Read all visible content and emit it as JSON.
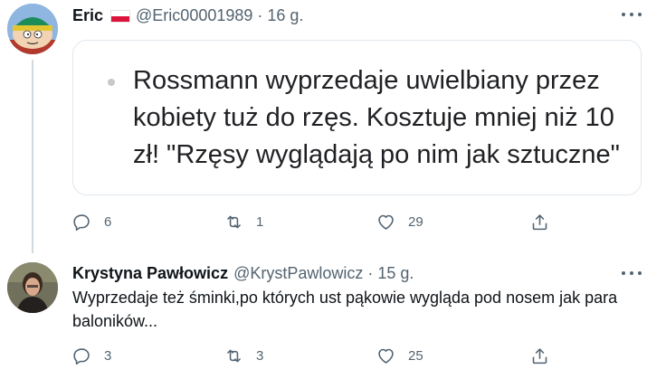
{
  "tweets": [
    {
      "name": "Eric",
      "handle": "@Eric00001989",
      "dot": "·",
      "time": "16 g.",
      "card_text": "Rossmann wyprzedaje uwielbiany przez kobiety tuż do rzęs. Kosztuje mniej niż 10 zł! \"Rzęsy wyglądają po nim jak sztuczne\"",
      "replies": "6",
      "retweets": "1",
      "likes": "29"
    },
    {
      "name": "Krystyna Pawłowicz",
      "handle": "@KrystPawlowicz",
      "dot": "·",
      "time": "15 g.",
      "text": "Wyprzedaje też śminki,po których ust pąkowie wygląda pod nosem jak para baloników...",
      "replies": "3",
      "retweets": "3",
      "likes": "25"
    }
  ],
  "colors": {
    "secondary": "#536471",
    "divider": "#cfd9de",
    "flag_red": "#dc143c"
  },
  "icons": [
    "reply-icon",
    "retweet-icon",
    "like-icon",
    "share-icon",
    "more-icon",
    "poland-flag-icon"
  ]
}
